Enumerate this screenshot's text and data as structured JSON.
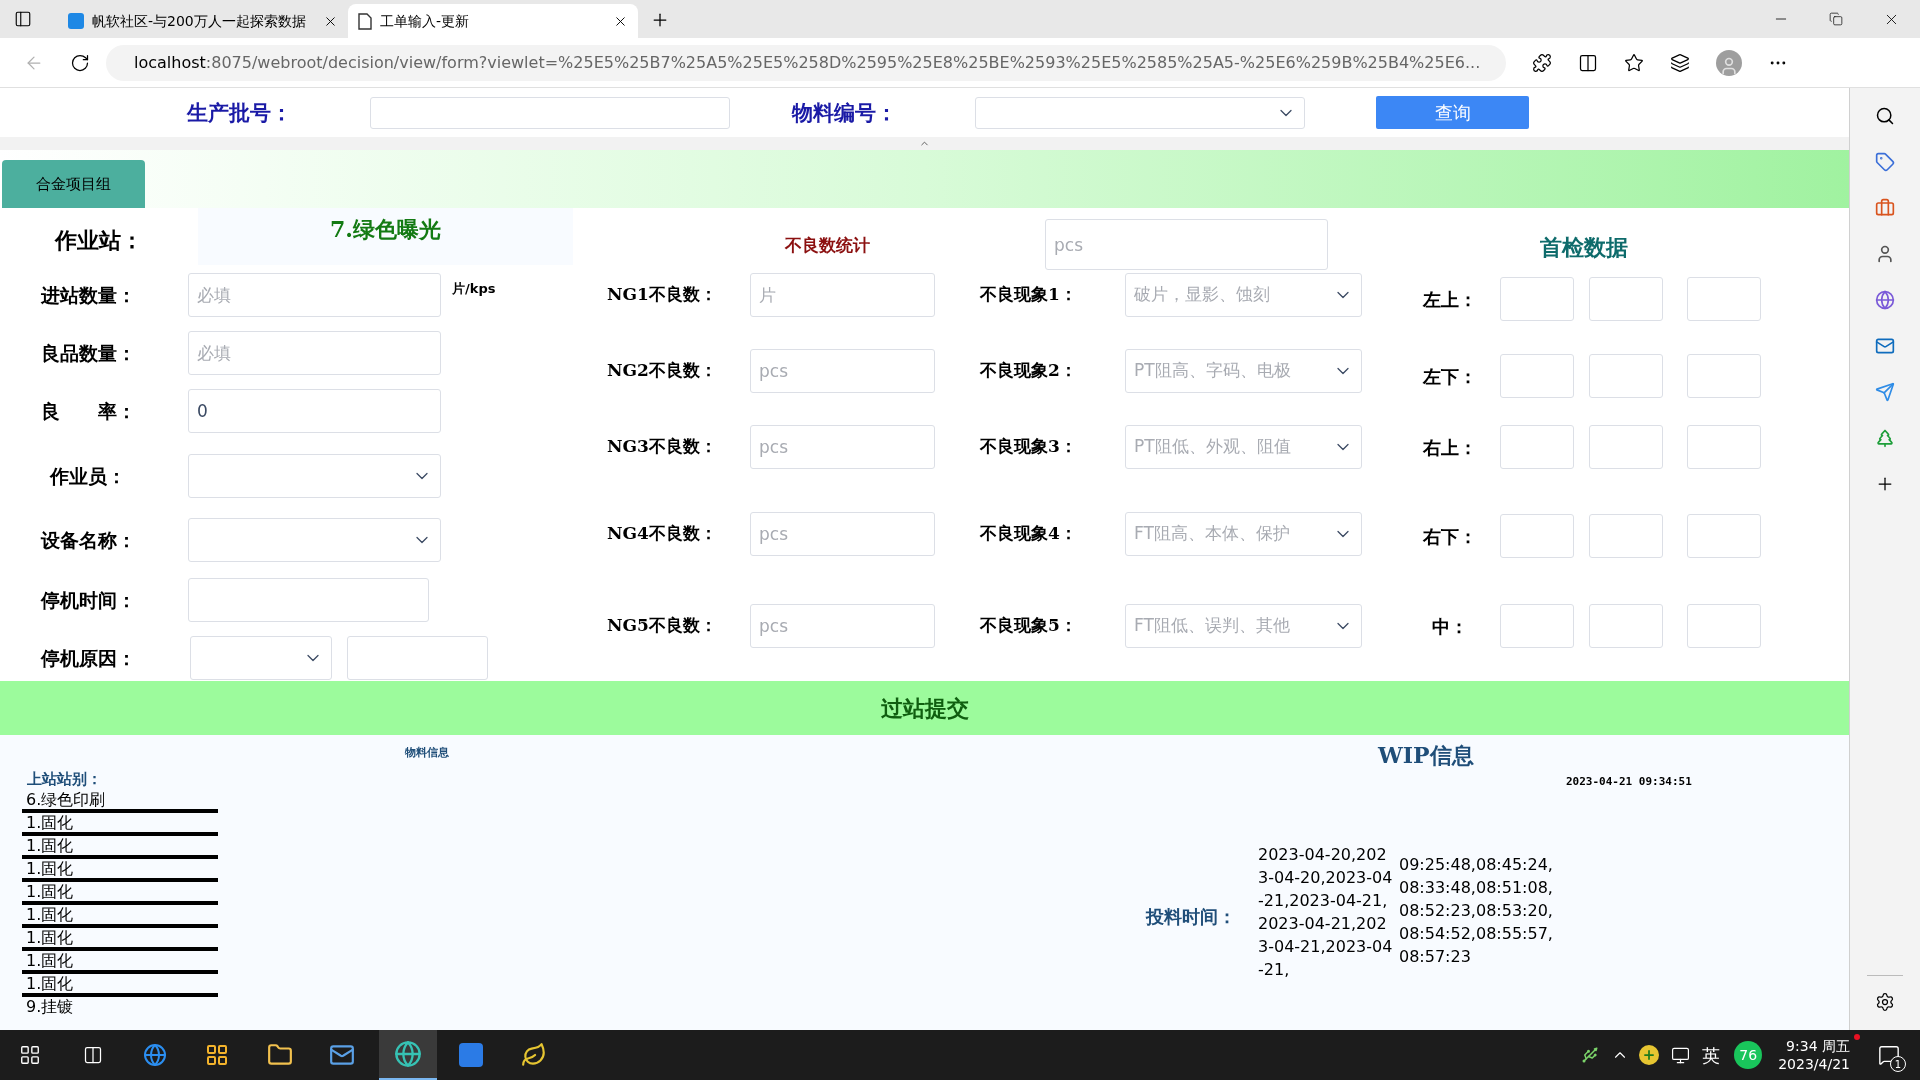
{
  "browser": {
    "tabs": [
      {
        "title": "帆软社区-与200万人一起探索数据",
        "selected": false
      },
      {
        "title": "工单输入-更新",
        "selected": true
      }
    ],
    "url_host": "localhost",
    "url_rest": ":8075/webroot/decision/view/form?viewlet=%25E5%25B7%25A5%25E5%258D%2595%25E8%25BE%2593%25E5%2585%25A5-%25E6%259B%25B4%25E6..."
  },
  "query_bar": {
    "fields": [
      {
        "label": "生产批号：",
        "kind": "text"
      },
      {
        "label": "物料编号：",
        "kind": "select"
      }
    ],
    "button": "查询"
  },
  "group_tab": "合金项目组",
  "station": {
    "label": "作业站：",
    "value": "7.绿色曝光"
  },
  "left_fields": [
    {
      "label": "进站数量：",
      "kind": "text",
      "placeholder": "必填",
      "unit": "片/kps"
    },
    {
      "label": "良品数量：",
      "kind": "text",
      "placeholder": "必填"
    },
    {
      "label": "良　　率：",
      "kind": "text",
      "value": "0"
    },
    {
      "label": "作业员：",
      "kind": "select"
    },
    {
      "label": "设备名称：",
      "kind": "select"
    },
    {
      "label": "停机时间：",
      "kind": "short_text"
    },
    {
      "label": "停机原因：",
      "kind": "select_text"
    }
  ],
  "defects": {
    "title": "不良数统计",
    "total_placeholder": "pcs",
    "rows": [
      {
        "label": "NG1不良数：",
        "placeholder": "片",
        "phenomenon_label": "不良现象1：",
        "phenomenon_placeholder": "破片，显影、蚀刻"
      },
      {
        "label": "NG2不良数：",
        "placeholder": "pcs",
        "phenomenon_label": "不良现象2：",
        "phenomenon_placeholder": "PT阻高、字码、电极"
      },
      {
        "label": "NG3不良数：",
        "placeholder": "pcs",
        "phenomenon_label": "不良现象3：",
        "phenomenon_placeholder": "PT阻低、外观、阻值"
      },
      {
        "label": "NG4不良数：",
        "placeholder": "pcs",
        "phenomenon_label": "不良现象4：",
        "phenomenon_placeholder": "FT阻高、本体、保护"
      },
      {
        "label": "NG5不良数：",
        "placeholder": "pcs",
        "phenomenon_label": "不良现象5：",
        "phenomenon_placeholder": "FT阻低、误判、其他"
      }
    ]
  },
  "first_inspection": {
    "title": "首检数据",
    "rows": [
      {
        "label": "左上："
      },
      {
        "label": "左下："
      },
      {
        "label": "右上："
      },
      {
        "label": "右下："
      },
      {
        "label": "中："
      }
    ]
  },
  "submit_bar": "过站提交",
  "material_info": {
    "title": "物料信息",
    "prev_station_label": "上站站别：",
    "prev_stations": [
      "6.绿色印刷",
      "1.固化",
      "1.固化",
      "1.固化",
      "1.固化",
      "1.固化",
      "1.固化",
      "1.固化",
      "1.固化",
      "9.挂镀"
    ]
  },
  "wip": {
    "title": "WIP信息",
    "timestamp": "2023-04-21 09:34:51",
    "feed_time_label": "投料时间：",
    "dates": "2023-04-20,2023-04-20,2023-04-21,2023-04-21,2023-04-21,2023-04-21,2023-04-21,",
    "times": "09:25:48,08:45:24,08:33:48,08:51:08,08:52:23,08:53:20,08:54:52,08:55:57,08:57:23"
  },
  "taskbar": {
    "ime": "英",
    "badge": "76",
    "time": "9:34 周五",
    "date": "2023/4/21",
    "notifications": "1"
  }
}
